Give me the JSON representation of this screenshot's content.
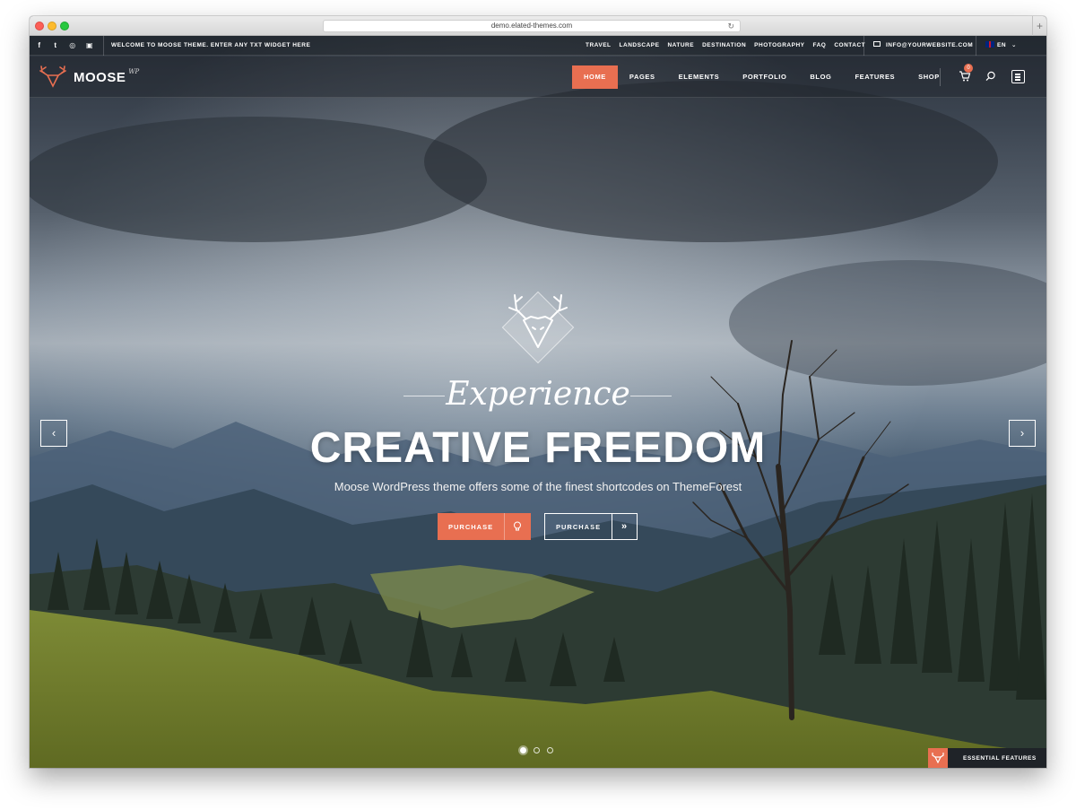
{
  "browser": {
    "url": "demo.elated-themes.com"
  },
  "topbar": {
    "social": [
      "facebook-icon",
      "twitter-icon",
      "dribbble-icon",
      "instagram-icon"
    ],
    "welcome": "WELCOME TO MOOSE THEME. ENTER ANY TXT WIDGET HERE",
    "links": [
      "TRAVEL",
      "LANDSCAPE",
      "NATURE",
      "DESTINATION",
      "PHOTOGRAPHY",
      "FAQ",
      "CONTACT"
    ],
    "email": "INFO@YOURWEBSITE.COM",
    "language": "EN"
  },
  "header": {
    "logo_text": "MOOSE",
    "logo_sup": "WP",
    "menu": [
      "HOME",
      "PAGES",
      "ELEMENTS",
      "PORTFOLIO",
      "BLOG",
      "FEATURES",
      "SHOP"
    ],
    "active_item": "HOME",
    "cart_count": "0"
  },
  "slider": {
    "script_title": "Experience",
    "headline": "CREATIVE FREEDOM",
    "subline": "Moose WordPress theme offers some of the finest shortcodes on ThemeForest",
    "button_primary": "PURCHASE",
    "button_secondary": "PURCHASE",
    "prev_glyph": "‹",
    "next_glyph": "›",
    "slide_count": 3,
    "active_slide": 1
  },
  "essential": {
    "label": "ESSENTIAL FEATURES"
  },
  "colors": {
    "accent": "#e86f51",
    "dark": "#1f2328"
  }
}
